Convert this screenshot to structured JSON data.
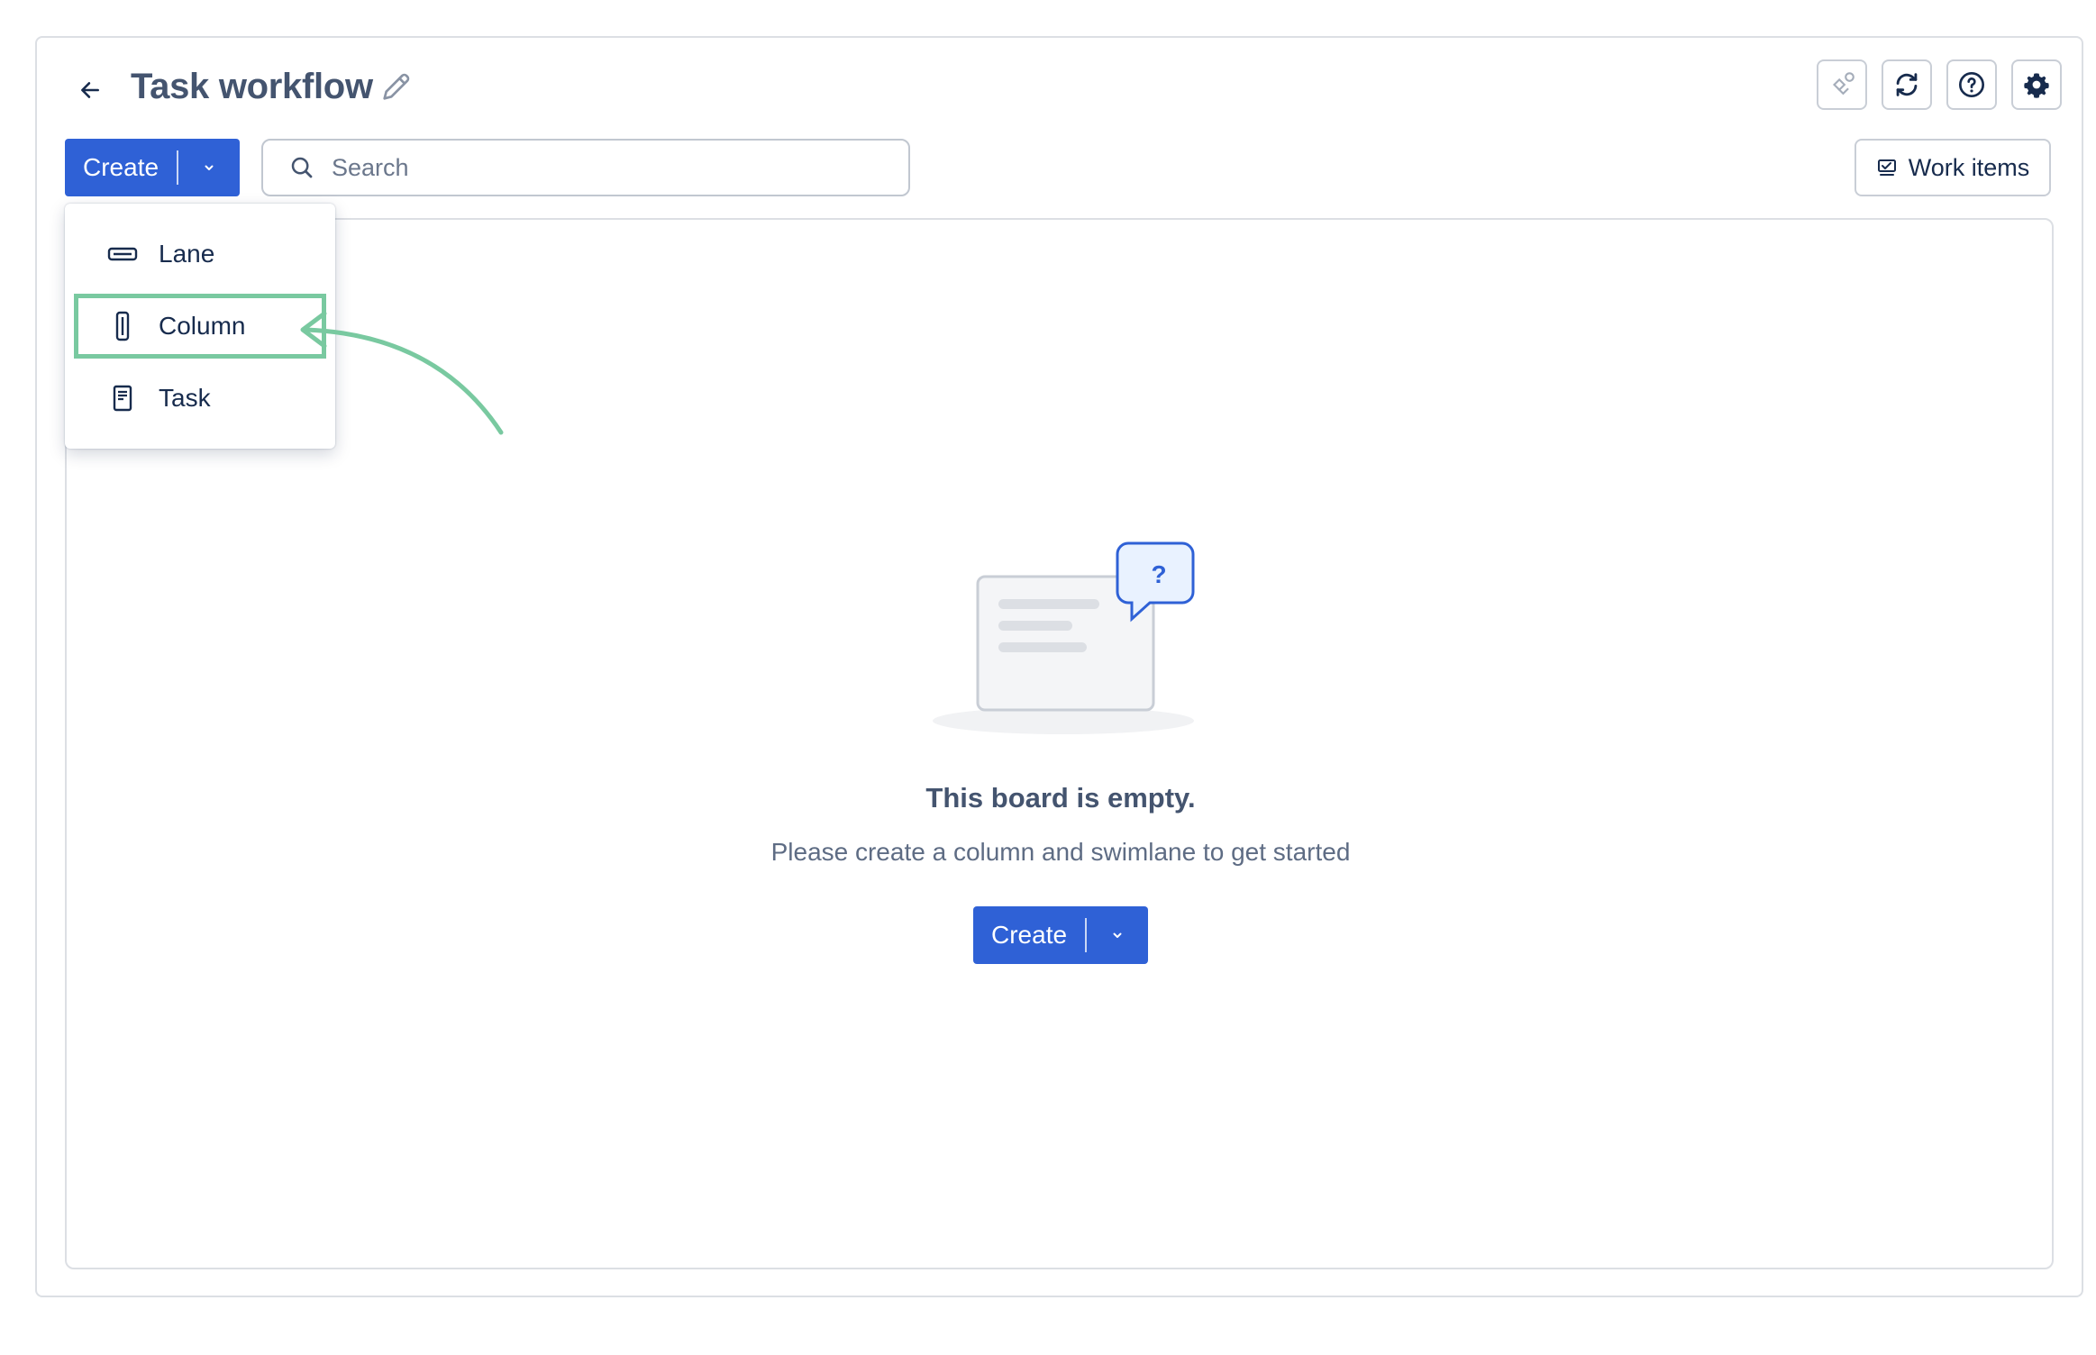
{
  "header": {
    "title": "Task workflow",
    "icons": [
      "back-arrow-icon",
      "pencil-icon",
      "integration-icon",
      "sync-icon",
      "help-icon",
      "gear-icon"
    ]
  },
  "toolbar": {
    "create_label": "Create",
    "search_placeholder": "Search",
    "work_items_label": "Work items"
  },
  "create_menu": {
    "items": [
      {
        "label": "Lane",
        "icon": "lane-icon"
      },
      {
        "label": "Column",
        "icon": "column-icon",
        "highlighted": true
      },
      {
        "label": "Task",
        "icon": "task-icon"
      }
    ]
  },
  "empty_state": {
    "title": "This board is empty.",
    "subtitle": "Please create a column and swimlane to get started",
    "create_label": "Create"
  },
  "colors": {
    "primary": "#2f61d6",
    "highlight": "#79c9a0",
    "title_text": "#44546f"
  }
}
